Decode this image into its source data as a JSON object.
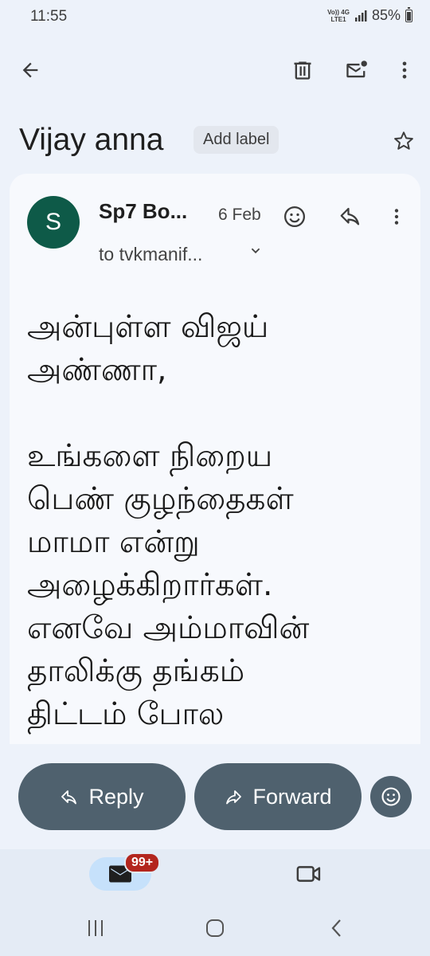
{
  "status": {
    "time": "11:55",
    "network_top": "Vo)) 4G",
    "network_bottom": "LTE1",
    "battery": "85%"
  },
  "toolbar": {
    "back_icon": "arrow-left-icon",
    "delete_icon": "trash-icon",
    "unread_icon": "mail-unread-icon",
    "more_icon": "more-vert-icon"
  },
  "email": {
    "subject": "Vijay anna",
    "label_chip": "Add label",
    "avatar_letter": "S",
    "sender": "Sp7 Bo...",
    "date": "6 Feb",
    "recipient": "to tvkmanif...",
    "body": "அன்புள்ள விஜய்\nஅண்ணா,\n\nஉங்களை நிறைய\nபெண் குழந்தைகள்\nமாமா என்று\nஅழைக்கிறார்கள்.\nஎனவே அம்மாவின்\nதாலிக்கு தங்கம்\nதிட்டம் போல"
  },
  "actions": {
    "reply": "Reply",
    "forward": "Forward"
  },
  "bottom_nav": {
    "mail_badge": "99+"
  },
  "colors": {
    "background": "#edf2fa",
    "card": "#f7f9fd",
    "avatar": "#0e5a48",
    "pill": "#4f616e",
    "badge": "#b3261e",
    "nav_active": "#c6e1fb"
  }
}
